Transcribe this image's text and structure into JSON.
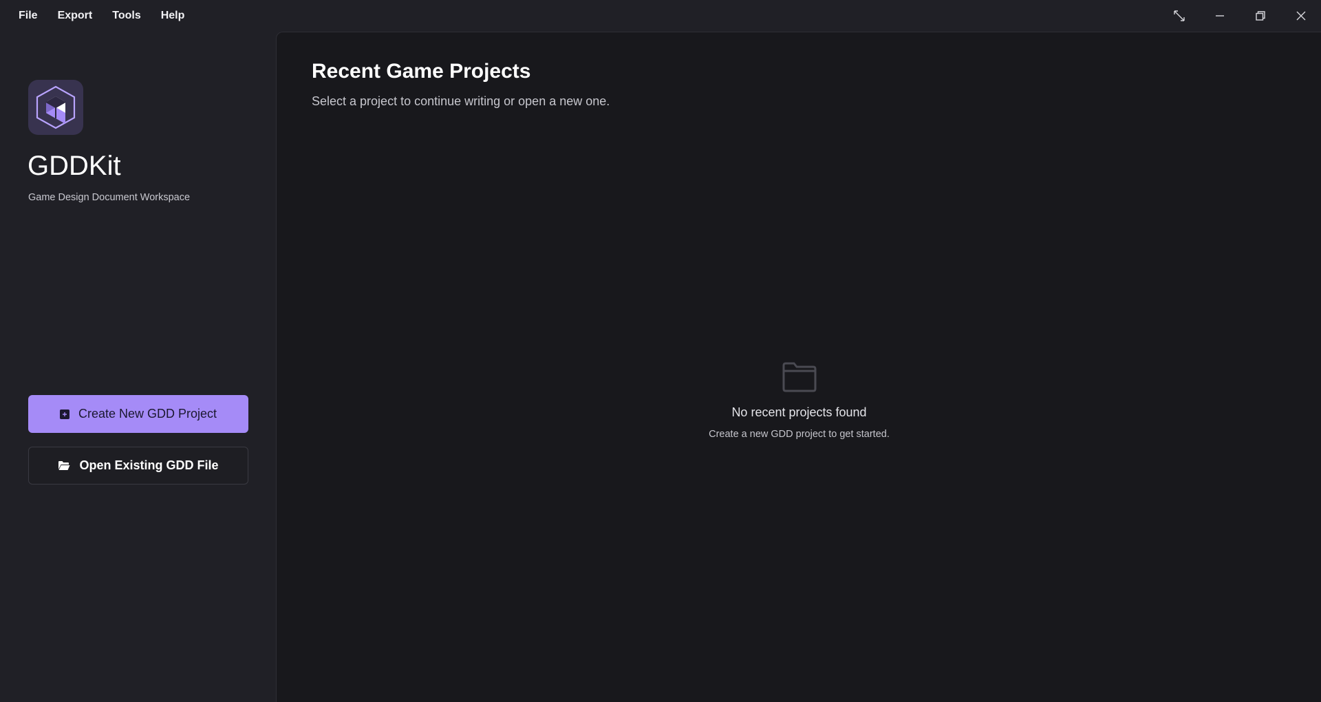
{
  "menu": {
    "items": [
      "File",
      "Export",
      "Tools",
      "Help"
    ]
  },
  "window_controls": [
    "expand-icon",
    "minimize-icon",
    "restore-icon",
    "close-icon"
  ],
  "sidebar": {
    "app_name": "GDDKit",
    "tagline": "Game Design Document Workspace",
    "create_button": "Create New GDD Project",
    "open_button": "Open Existing GDD File"
  },
  "main": {
    "title": "Recent Game Projects",
    "subtitle": "Select a project to continue writing or open a new one.",
    "empty_title": "No recent projects found",
    "empty_subtitle": "Create a new GDD project to get started."
  },
  "colors": {
    "accent": "#a58bf7",
    "sidebar_bg": "#202026",
    "main_bg": "#18181c",
    "logo_bg": "#38334f"
  }
}
